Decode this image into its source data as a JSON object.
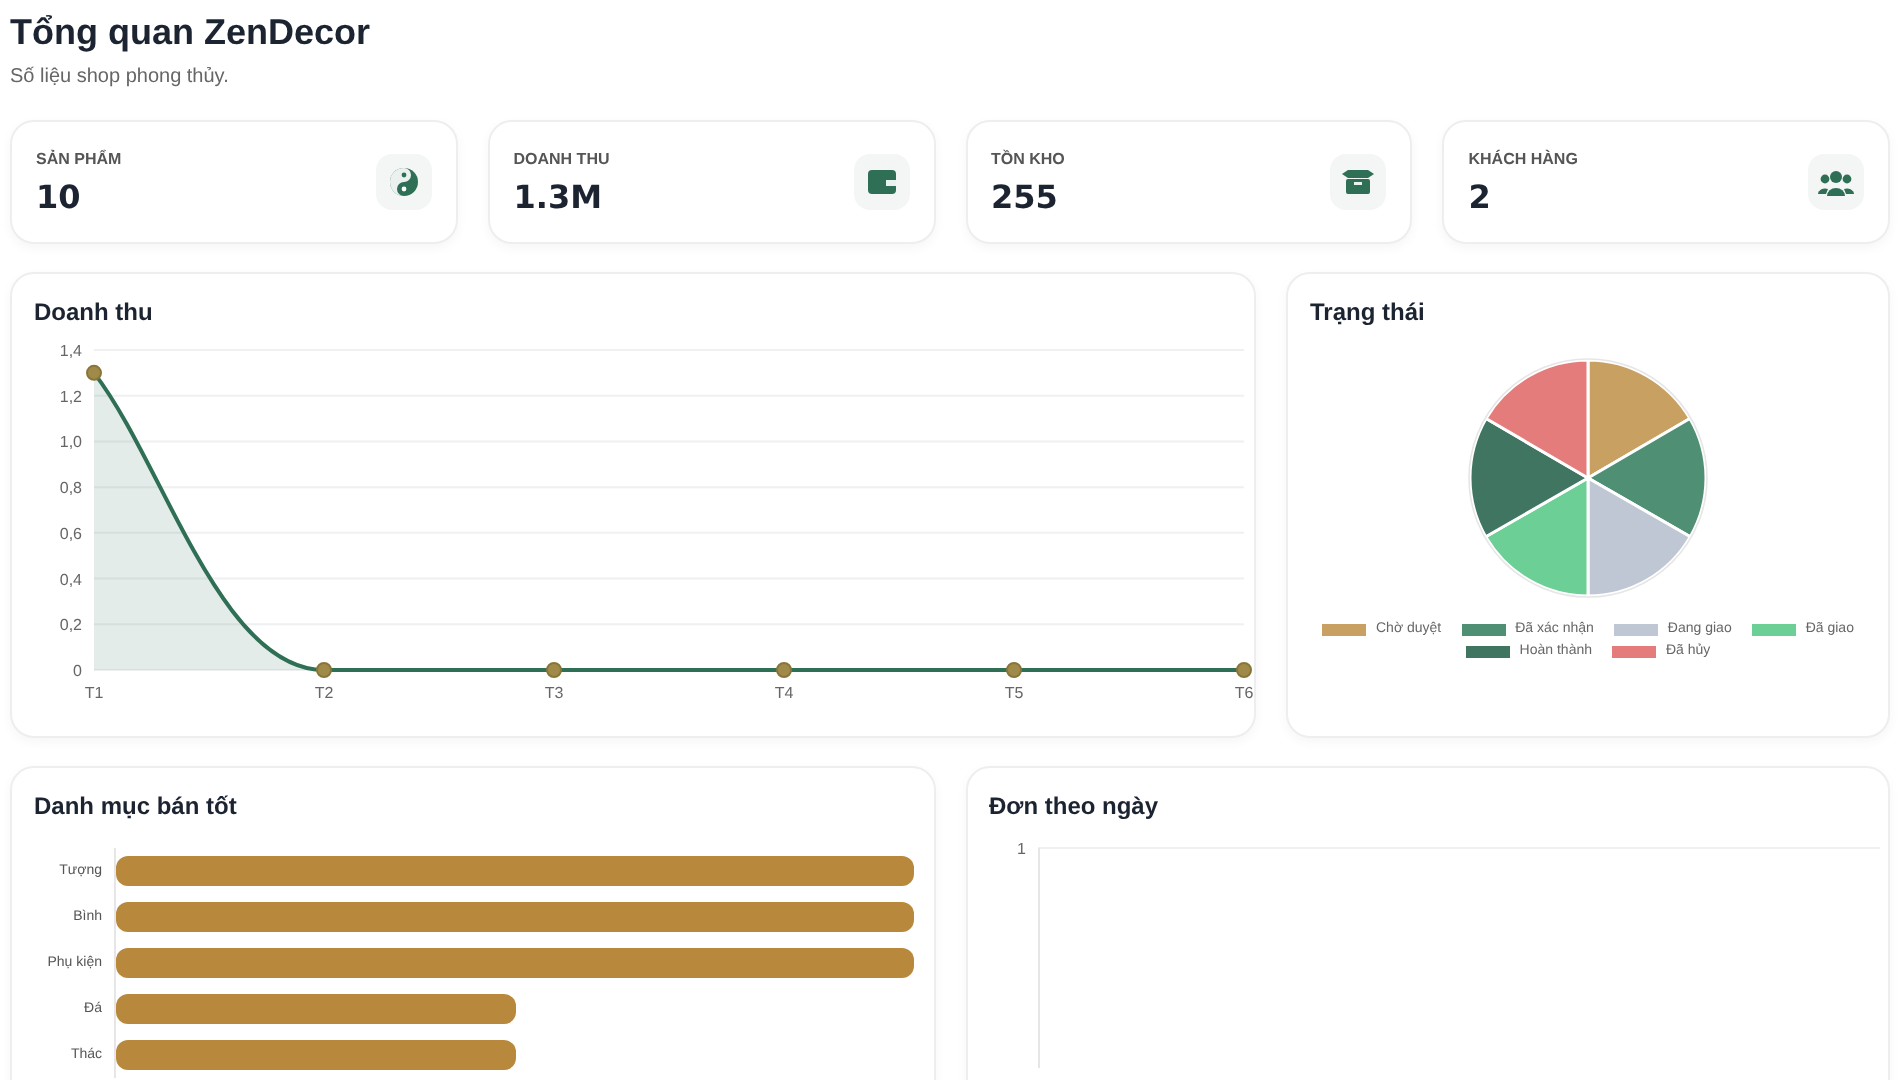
{
  "header": {
    "title": "Tổng quan ZenDecor",
    "subtitle": "Số liệu shop phong thủy."
  },
  "stats": [
    {
      "label": "SẢN PHẨM",
      "value": "10",
      "kind": "yinyang"
    },
    {
      "label": "DOANH THU",
      "value": "1.3M",
      "kind": "wallet"
    },
    {
      "label": "TỒN KHO",
      "value": "255",
      "kind": "box"
    },
    {
      "label": "KHÁCH HÀNG",
      "value": "2",
      "kind": "users"
    }
  ],
  "revenue": {
    "title": "Doanh thu",
    "chart_data": {
      "type": "area",
      "grid": true,
      "categories": [
        "T1",
        "T2",
        "T3",
        "T4",
        "T5",
        "T6"
      ],
      "values": [
        1.3,
        0,
        0,
        0,
        0,
        0
      ],
      "ylim": [
        0,
        1.4
      ],
      "yticks": [
        {
          "value": 0,
          "label": "0"
        },
        {
          "value": 0.2,
          "label": "0,2"
        },
        {
          "value": 0.4,
          "label": "0,4"
        },
        {
          "value": 0.6,
          "label": "0,6"
        },
        {
          "value": 0.8,
          "label": "0,8"
        },
        {
          "value": 1,
          "label": "1,0"
        },
        {
          "value": 1.2,
          "label": "1,2"
        },
        {
          "value": 1.4,
          "label": "1,4"
        }
      ]
    }
  },
  "status": {
    "title": "Trạng thái",
    "chart_data": {
      "type": "pie",
      "categories": [
        "Chờ duyệt",
        "Đã xác nhận",
        "Đang giao",
        "Đã giao",
        "Hoàn thành",
        "Đã hủy"
      ],
      "values": [
        16.6,
        16.7,
        16.7,
        16.7,
        16.7,
        16.6
      ],
      "legend": "bottom"
    },
    "swatches": [
      {
        "color": "#c8a062"
      },
      {
        "color": "#4f8f74"
      },
      {
        "color": "#bec7d3"
      },
      {
        "color": "#6ccf95"
      },
      {
        "color": "#3f7561"
      },
      {
        "color": "#e57c7c"
      }
    ]
  },
  "top_categories": {
    "title": "Danh mục bán tốt",
    "bars": [
      {
        "label": "Tượng",
        "level": 1
      },
      {
        "label": "Bình",
        "level": 1
      },
      {
        "label": "Phụ kiện",
        "level": 1
      },
      {
        "label": "Đá",
        "level": 0.5
      },
      {
        "label": "Thác",
        "level": 0.5
      }
    ]
  },
  "daily_orders": {
    "title": "Đơn theo ngày",
    "axis_label": "1"
  }
}
